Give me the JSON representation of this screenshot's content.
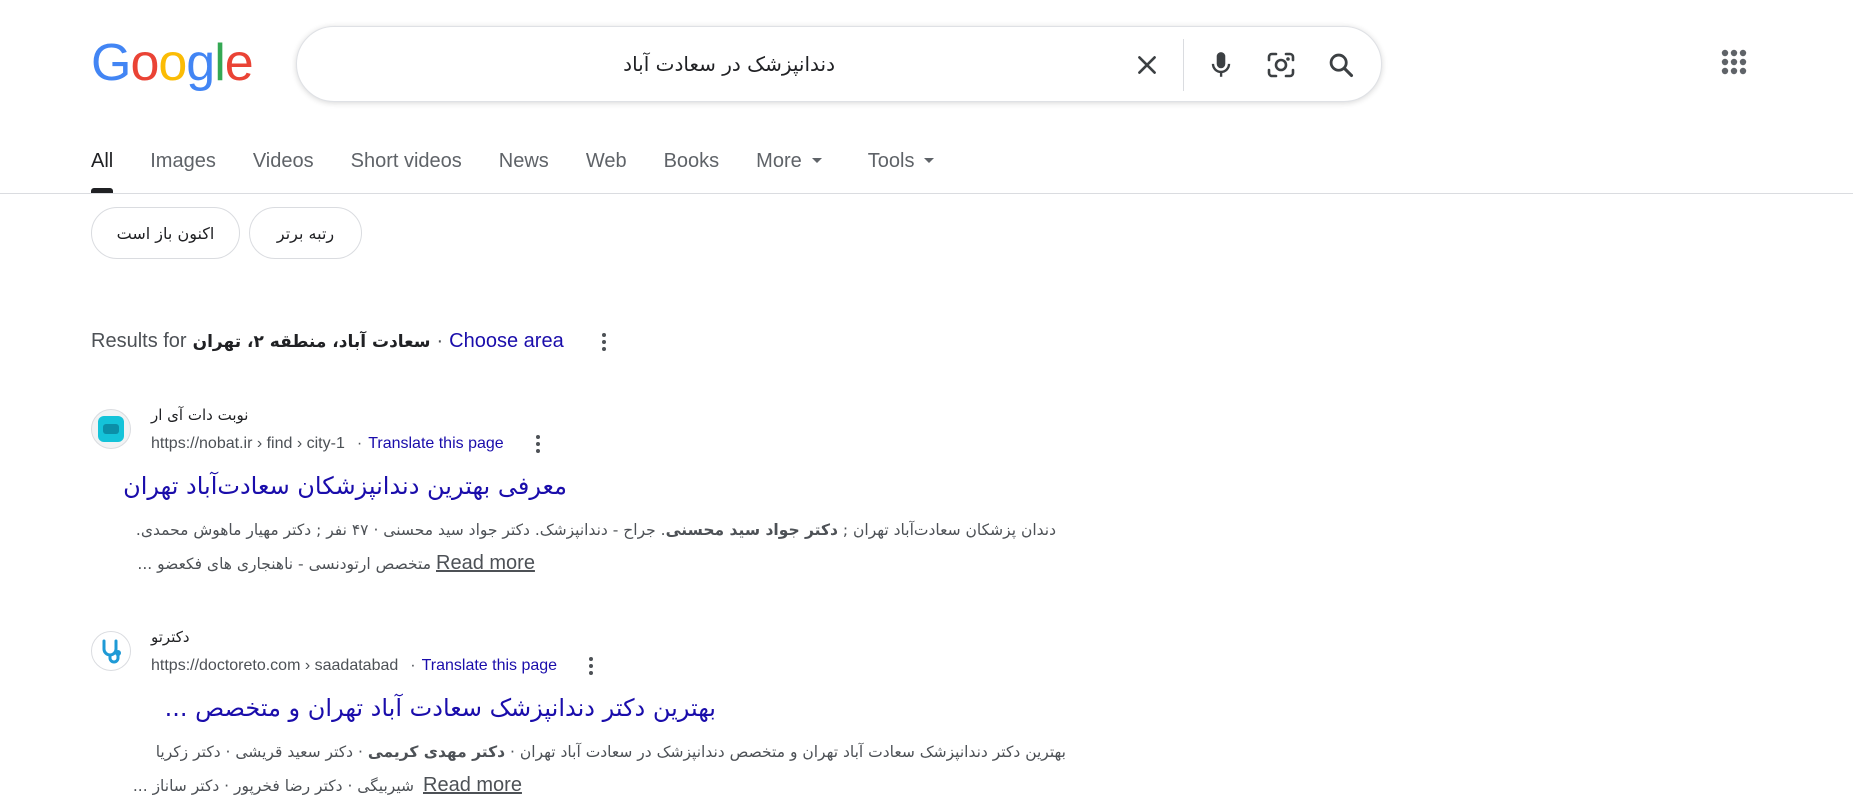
{
  "logo": {
    "text": "Google",
    "letters": [
      {
        "ch": "G",
        "color": "#4285F4"
      },
      {
        "ch": "o",
        "color": "#EA4335"
      },
      {
        "ch": "o",
        "color": "#FBBC05"
      },
      {
        "ch": "g",
        "color": "#4285F4"
      },
      {
        "ch": "l",
        "color": "#34A853"
      },
      {
        "ch": "e",
        "color": "#EA4335"
      }
    ]
  },
  "search": {
    "query": "دندانپزشک در سعادت آباد"
  },
  "tabs": [
    {
      "label": "All",
      "active": true
    },
    {
      "label": "Images"
    },
    {
      "label": "Videos"
    },
    {
      "label": "Short videos"
    },
    {
      "label": "News"
    },
    {
      "label": "Web"
    },
    {
      "label": "Books"
    },
    {
      "label": "More",
      "dropdown": true
    },
    {
      "label": "Tools",
      "dropdown": true
    }
  ],
  "chips": [
    {
      "label": "اکنون باز است"
    },
    {
      "label": "رتبه برتر"
    }
  ],
  "results_for": {
    "prefix": "Results for",
    "location": "سعادت آباد، منطقه ۲، تهران",
    "separator": "·",
    "choose_area": "Choose area"
  },
  "results": [
    {
      "site_name": "نوبت دات آی ار",
      "url": "https://nobat.ir › find › city-1",
      "translate": "Translate this page",
      "title": "معرفی بهترین دندانپزشکان سعادت‌آباد تهران",
      "snippet_line1_a": "دندان پزشکان سعادت‌آباد تهران ; ",
      "snippet_line1_bold": "دکتر جواد سید محسنی",
      "snippet_line1_b": ". جراح - دندانپزشک. دکتر جواد سید محسنی · ۴۷ نفر ; دکتر مهیار ماهوش محمدی.",
      "snippet_line2": "متخصص ارتودنسی - ناهنجاری های فکعضو ...",
      "read_more": "Read more"
    },
    {
      "site_name": "دکترتو",
      "url": "https://doctoreto.com › saadatabad",
      "translate": "Translate this page",
      "title": "بهترین دکتر دندانپزشک سعادت آباد تهران و متخصص ...",
      "snippet_line1_a": "بهترین دکتر دندانپزشک سعادت آباد تهران و متخصص دندانپزشک در سعادت آباد تهران · ",
      "snippet_line1_bold": "دکتر مهدی کریمی",
      "snippet_line1_b": " · دکتر سعید قریشی · دکتر زکریا",
      "snippet_line2": "شیربیگی · دکتر رضا فخرپور · دکتر ساناز ...",
      "read_more": "Read more"
    }
  ],
  "colors": {
    "link": "#1a0dab",
    "text": "#202124",
    "muted": "#4d5156",
    "border": "#dadce0"
  }
}
